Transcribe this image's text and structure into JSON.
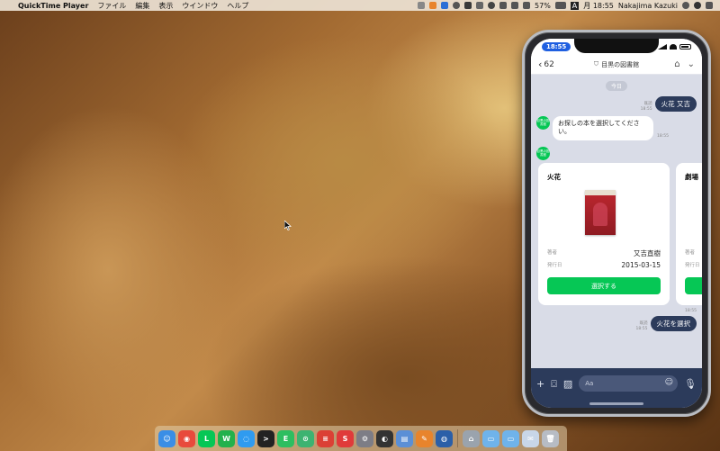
{
  "menubar": {
    "app_name": "QuickTime Player",
    "menus": [
      "ファイル",
      "編集",
      "表示",
      "ウインドウ",
      "ヘルプ"
    ],
    "battery": "57%",
    "input_mode": "A",
    "clock": "月 18:55",
    "user": "Nakajima Kazuki"
  },
  "phone": {
    "status_time": "18:55",
    "nav": {
      "back_count": "62",
      "title": "目黒の図書館"
    },
    "date_label": "今日",
    "user_msg_1": {
      "text": "火花 又吉",
      "meta": "既読\n18:55"
    },
    "bot_avatar_text": "目黒の図書館",
    "bot_msg_1": {
      "text": "お探しの本を選択してください。",
      "meta": "18:55"
    },
    "cards": [
      {
        "title": "火花",
        "author_label": "著者",
        "author": "又吉直樹",
        "date_label": "発行日",
        "date": "2015-03-15",
        "button": "選択する"
      },
      {
        "title": "劇場",
        "author_label": "著者",
        "date_label": "発行日"
      }
    ],
    "user_msg_2": {
      "text": "火花を選択",
      "meta": "既読\n18:55"
    },
    "card_meta": "18:55",
    "input": {
      "placeholder": "Aa"
    }
  },
  "dock": {
    "apps": [
      {
        "name": "finder",
        "color": "#3a8ee6",
        "glyph": "☺"
      },
      {
        "name": "chrome",
        "color": "#e84a3c",
        "glyph": "◉"
      },
      {
        "name": "line",
        "color": "#06c755",
        "glyph": "L"
      },
      {
        "name": "wechat",
        "color": "#22b14c",
        "glyph": "W"
      },
      {
        "name": "messages",
        "color": "#2f9bf0",
        "glyph": "◌"
      },
      {
        "name": "terminal",
        "color": "#222222",
        "glyph": ">"
      },
      {
        "name": "evernote",
        "color": "#2dbe60",
        "glyph": "E"
      },
      {
        "name": "app-green",
        "color": "#3cb371",
        "glyph": "⊙"
      },
      {
        "name": "todoist",
        "color": "#db4035",
        "glyph": "≡"
      },
      {
        "name": "app-s",
        "color": "#e03a3a",
        "glyph": "S"
      },
      {
        "name": "preferences",
        "color": "#7d7d86",
        "glyph": "⚙"
      },
      {
        "name": "app-black",
        "color": "#333333",
        "glyph": "◐"
      },
      {
        "name": "preview",
        "color": "#5b8fd6",
        "glyph": "▤"
      },
      {
        "name": "app-orange",
        "color": "#e8842c",
        "glyph": "✎"
      },
      {
        "name": "app-globe",
        "color": "#2b5fa8",
        "glyph": "◍"
      },
      {
        "name": "home-folder",
        "color": "#9aa3ad",
        "glyph": "⌂"
      },
      {
        "name": "folder",
        "color": "#6fb3ea",
        "glyph": "▭"
      },
      {
        "name": "folder-2",
        "color": "#6fb3ea",
        "glyph": "▭"
      },
      {
        "name": "mail",
        "color": "#c8d6e8",
        "glyph": "✉"
      },
      {
        "name": "trash",
        "color": "#b7bcc4",
        "glyph": "🗑"
      }
    ]
  }
}
